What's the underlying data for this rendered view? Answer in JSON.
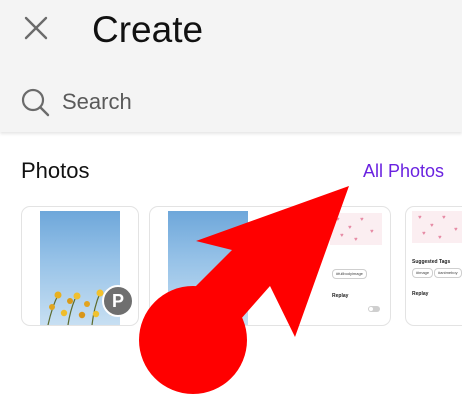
{
  "header": {
    "title": "Create",
    "close_icon": "close-icon"
  },
  "search": {
    "placeholder": "Search",
    "icon": "search-icon"
  },
  "photos_section": {
    "title": "Photos",
    "all_photos_link": "All Photos",
    "thumbnails": [
      {
        "kind": "photo",
        "badge": "P"
      },
      {
        "kind": "screenshot",
        "mini_text": [
          "#fullbodyimage",
          "Replay"
        ]
      },
      {
        "kind": "screenshot",
        "mini_text": [
          "Suggested Tags",
          "#image",
          "#animeboy",
          "Replay"
        ]
      }
    ]
  },
  "colors": {
    "header_bg": "#f4f4f4",
    "link_purple": "#6a22e0",
    "annotation_red": "#ff0000",
    "badge_gray": "#6f6f6f"
  }
}
